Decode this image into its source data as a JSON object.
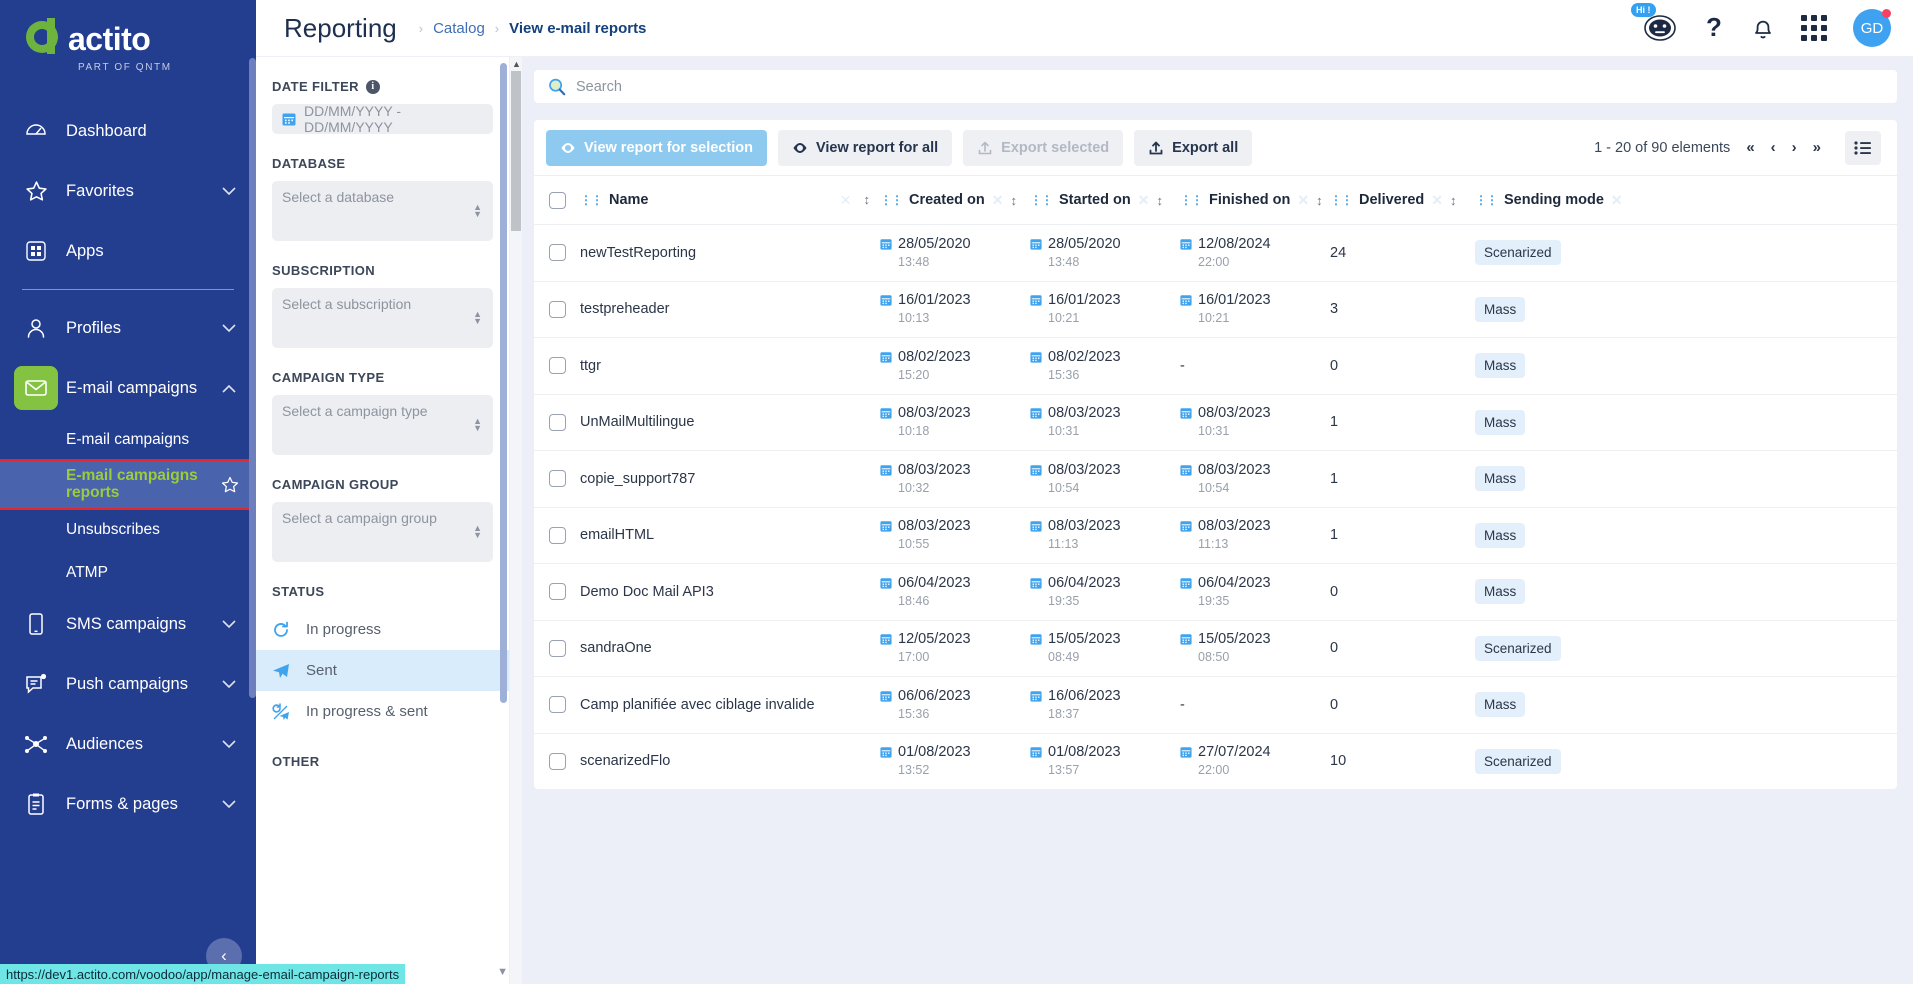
{
  "brand": {
    "name": "actito",
    "tagline": "PART OF QNTM",
    "green": "#84c341",
    "navy": "#233d8f",
    "accent_blue": "#8ecaf0"
  },
  "sidebar": {
    "items": [
      {
        "label": "Dashboard",
        "icon": "dashboard-icon",
        "chevron": ""
      },
      {
        "label": "Favorites",
        "icon": "star-icon",
        "chevron": "⌄"
      },
      {
        "label": "Apps",
        "icon": "apps-icon",
        "chevron": ""
      },
      {
        "label": "Profiles",
        "icon": "person-icon",
        "chevron": "⌄"
      },
      {
        "label": "E-mail campaigns",
        "icon": "envelope-icon",
        "chevron": "⌃"
      },
      {
        "label": "SMS campaigns",
        "icon": "phone-icon",
        "chevron": "⌄"
      },
      {
        "label": "Push campaigns",
        "icon": "push-icon",
        "chevron": "⌄"
      },
      {
        "label": "Audiences",
        "icon": "audiences-icon",
        "chevron": "⌄"
      },
      {
        "label": "Forms & pages",
        "icon": "clipboard-icon",
        "chevron": "⌄"
      }
    ],
    "subitems": [
      {
        "label": "E-mail campaigns",
        "active": false
      },
      {
        "label": "E-mail campaigns reports",
        "active": true
      },
      {
        "label": "Unsubscribes",
        "active": false
      },
      {
        "label": "ATMP",
        "active": false
      }
    ],
    "collapse_icon": "‹"
  },
  "header": {
    "title": "Reporting",
    "breadcrumb": [
      {
        "label": "Catalog",
        "current": false
      },
      {
        "label": "View e-mail reports",
        "current": true
      }
    ],
    "bot_badge": "Hi !",
    "help_icon": "?",
    "avatar_initials": "GD"
  },
  "filters": {
    "date": {
      "label": "DATE FILTER",
      "info": "i",
      "placeholder": "DD/MM/YYYY - DD/MM/YYYY"
    },
    "database": {
      "label": "DATABASE",
      "placeholder": "Select a database"
    },
    "subscription": {
      "label": "SUBSCRIPTION",
      "placeholder": "Select a subscription"
    },
    "campaign_type": {
      "label": "CAMPAIGN TYPE",
      "placeholder": "Select a campaign type"
    },
    "campaign_group": {
      "label": "CAMPAIGN GROUP",
      "placeholder": "Select a campaign group"
    },
    "status": {
      "label": "STATUS",
      "options": [
        {
          "label": "In progress",
          "icon": "refresh-icon",
          "selected": false
        },
        {
          "label": "Sent",
          "icon": "send-icon",
          "selected": true
        },
        {
          "label": "In progress & sent",
          "icon": "refresh-send-icon",
          "selected": false
        }
      ]
    },
    "other": {
      "label": "OTHER"
    }
  },
  "main": {
    "search_placeholder": "Search",
    "toolbar": {
      "view_selection": "View report for selection",
      "view_all": "View report for all",
      "export_selected": "Export selected",
      "export_all": "Export all"
    },
    "pagination": {
      "count_text": "1 - 20 of 90 elements",
      "first": "«",
      "prev": "‹",
      "next": "›",
      "last": "»"
    },
    "table": {
      "columns": [
        {
          "label": "Name",
          "key": "name"
        },
        {
          "label": "Created on",
          "key": "created"
        },
        {
          "label": "Started on",
          "key": "started"
        },
        {
          "label": "Finished on",
          "key": "finished"
        },
        {
          "label": "Delivered",
          "key": "delivered"
        },
        {
          "label": "Sending mode",
          "key": "mode"
        }
      ],
      "rows": [
        {
          "name": "newTestReporting",
          "created_d": "28/05/2020",
          "created_t": "13:48",
          "started_d": "28/05/2020",
          "started_t": "13:48",
          "finished_d": "12/08/2024",
          "finished_t": "22:00",
          "delivered": "24",
          "mode": "Scenarized"
        },
        {
          "name": "testpreheader",
          "created_d": "16/01/2023",
          "created_t": "10:13",
          "started_d": "16/01/2023",
          "started_t": "10:21",
          "finished_d": "16/01/2023",
          "finished_t": "10:21",
          "delivered": "3",
          "mode": "Mass"
        },
        {
          "name": "ttgr",
          "created_d": "08/02/2023",
          "created_t": "15:20",
          "started_d": "08/02/2023",
          "started_t": "15:36",
          "finished_d": "-",
          "finished_t": "",
          "delivered": "0",
          "mode": "Mass"
        },
        {
          "name": "UnMailMultilingue",
          "created_d": "08/03/2023",
          "created_t": "10:18",
          "started_d": "08/03/2023",
          "started_t": "10:31",
          "finished_d": "08/03/2023",
          "finished_t": "10:31",
          "delivered": "1",
          "mode": "Mass"
        },
        {
          "name": "copie_support787",
          "created_d": "08/03/2023",
          "created_t": "10:32",
          "started_d": "08/03/2023",
          "started_t": "10:54",
          "finished_d": "08/03/2023",
          "finished_t": "10:54",
          "delivered": "1",
          "mode": "Mass"
        },
        {
          "name": "emailHTML",
          "created_d": "08/03/2023",
          "created_t": "10:55",
          "started_d": "08/03/2023",
          "started_t": "11:13",
          "finished_d": "08/03/2023",
          "finished_t": "11:13",
          "delivered": "1",
          "mode": "Mass"
        },
        {
          "name": "Demo Doc Mail API3",
          "created_d": "06/04/2023",
          "created_t": "18:46",
          "started_d": "06/04/2023",
          "started_t": "19:35",
          "finished_d": "06/04/2023",
          "finished_t": "19:35",
          "delivered": "0",
          "mode": "Mass"
        },
        {
          "name": "sandraOne",
          "created_d": "12/05/2023",
          "created_t": "17:00",
          "started_d": "15/05/2023",
          "started_t": "08:49",
          "finished_d": "15/05/2023",
          "finished_t": "08:50",
          "delivered": "0",
          "mode": "Scenarized"
        },
        {
          "name": "Camp planifiée avec ciblage invalide",
          "created_d": "06/06/2023",
          "created_t": "15:36",
          "started_d": "16/06/2023",
          "started_t": "18:37",
          "finished_d": "-",
          "finished_t": "",
          "delivered": "0",
          "mode": "Mass"
        },
        {
          "name": "scenarizedFlo",
          "created_d": "01/08/2023",
          "created_t": "13:52",
          "started_d": "01/08/2023",
          "started_t": "13:57",
          "finished_d": "27/07/2024",
          "finished_t": "22:00",
          "delivered": "10",
          "mode": "Scenarized"
        }
      ]
    }
  },
  "statusbar": {
    "url": "https://dev1.actito.com/voodoo/app/manage-email-campaign-reports"
  }
}
